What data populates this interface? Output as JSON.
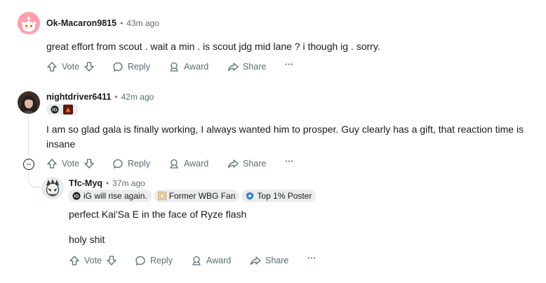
{
  "comments": [
    {
      "username": "Ok-Macaron9815",
      "time": "43m ago",
      "text": "great effort from scout . wait a min . is scout jdg mid lane ? i though ig . sorry.",
      "actions": {
        "vote": "Vote",
        "reply": "Reply",
        "award": "Award",
        "share": "Share",
        "more": "···"
      }
    },
    {
      "username": "nightdriver6411",
      "time": "42m ago",
      "text": "I am so glad gala is finally working, I always wanted him to prosper. Guy clearly has a gift, that reaction time is insane",
      "actions": {
        "vote": "Vote",
        "reply": "Reply",
        "award": "Award",
        "share": "Share",
        "more": "···"
      },
      "collapse": "−"
    },
    {
      "username": "Tfc-Myq",
      "time": "37m ago",
      "flairs": [
        "iG will rise again.",
        "Former WBG Fan",
        "Top 1% Poster"
      ],
      "text_lines": [
        "perfect Kai'Sa E in the face of Ryze flash",
        "holy shit"
      ],
      "actions": {
        "vote": "Vote",
        "reply": "Reply",
        "award": "Award",
        "share": "Share",
        "more": "···"
      }
    }
  ],
  "separator": "•",
  "colors": {
    "accent_reddit": "#ff4500",
    "meta": "#576f76",
    "thread_line": "#dadde0",
    "flair_bg": "#eaedef"
  }
}
